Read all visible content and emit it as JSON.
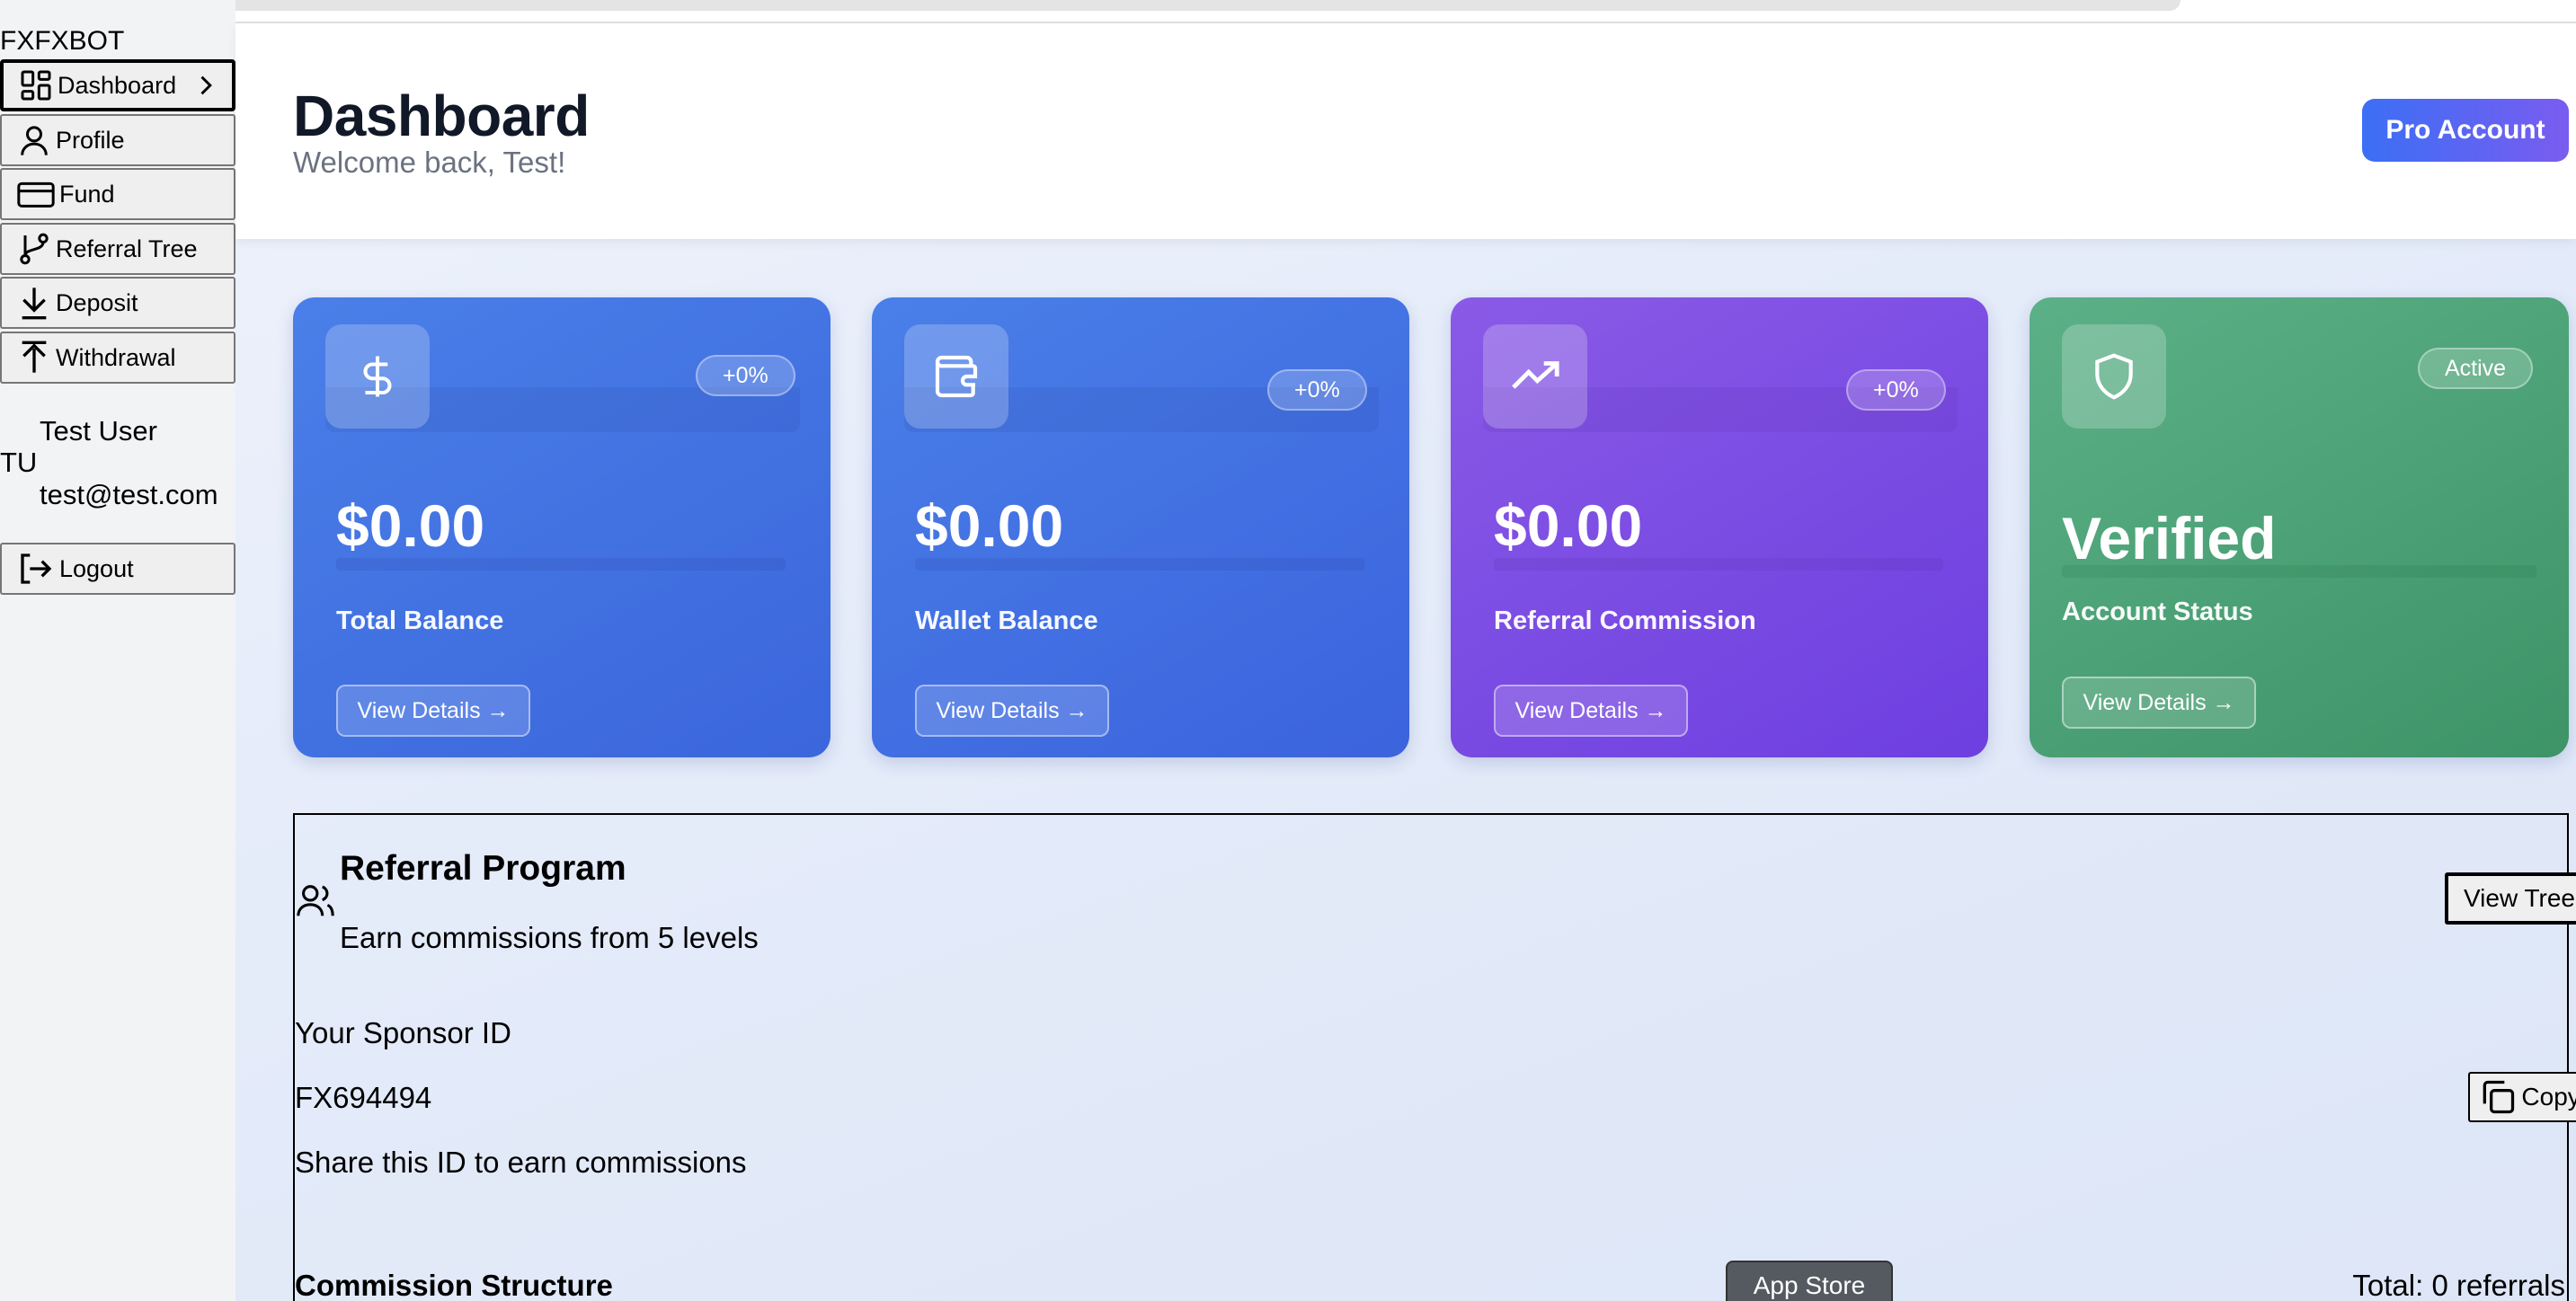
{
  "brand": "FXFXBOT",
  "nav": {
    "items": [
      {
        "label": "Dashboard",
        "icon": "dashboard-grid-icon",
        "active": true
      },
      {
        "label": "Profile",
        "icon": "user-icon"
      },
      {
        "label": "Fund",
        "icon": "credit-card-icon"
      },
      {
        "label": "Referral Tree",
        "icon": "git-branch-icon"
      },
      {
        "label": "Deposit",
        "icon": "arrow-down-icon"
      },
      {
        "label": "Withdrawal",
        "icon": "arrow-up-icon"
      }
    ]
  },
  "user": {
    "name": "Test User",
    "initials": "TU",
    "email": "test@test.com"
  },
  "logout_label": "Logout",
  "header": {
    "title": "Dashboard",
    "subtitle": "Welcome back, Test!",
    "pro_button": "Pro Account"
  },
  "cards": [
    {
      "amount": "$0.00",
      "label": "Total Balance",
      "badge": "+0%",
      "button": "View Details →",
      "icon": "dollar-icon"
    },
    {
      "amount": "$0.00",
      "label": "Wallet Balance",
      "badge": "+0%",
      "button": "View Details →",
      "icon": "wallet-icon"
    },
    {
      "amount": "$0.00",
      "label": "Referral Commission",
      "badge": "+0%",
      "button": "View Details →",
      "icon": "trending-up-icon"
    },
    {
      "amount": "Verified",
      "label": "Account Status",
      "badge": "Active",
      "button": "View Details →",
      "icon": "shield-icon"
    }
  ],
  "referral": {
    "title": "Referral Program",
    "subtitle": "Earn commissions from 5 levels",
    "view_tree": "View Tree",
    "sponsor_label": "Your Sponsor ID",
    "sponsor_id": "FX694494",
    "sponsor_note": "Share this ID to earn commissions",
    "copy_button": "Copy ID",
    "commission_title": "Commission Structure",
    "total_referrals": "Total: 0 referrals"
  },
  "app_store": "App Store",
  "colors": {
    "card_blue": "#4a7fe8",
    "card_purple": "#7c4ce3",
    "card_green": "#4ea277",
    "pro_button_start": "#3b6ff5",
    "pro_button_end": "#7a5cf0"
  }
}
